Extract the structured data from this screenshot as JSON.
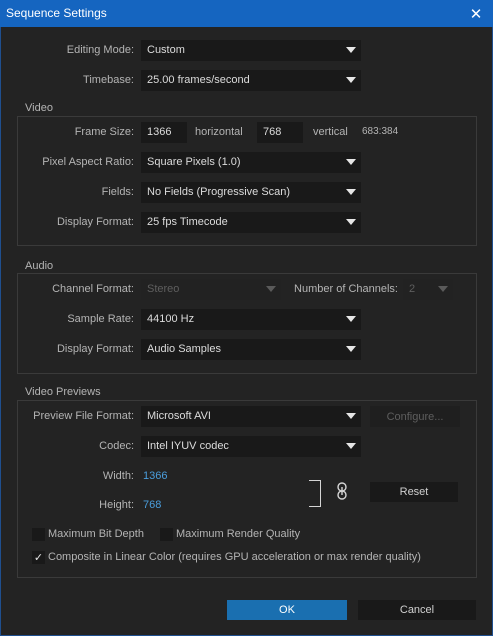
{
  "window": {
    "title": "Sequence Settings"
  },
  "general": {
    "editing_mode_label": "Editing Mode:",
    "editing_mode_value": "Custom",
    "timebase_label": "Timebase:",
    "timebase_value": "25.00 frames/second"
  },
  "video": {
    "group_title": "Video",
    "frame_size_label": "Frame Size:",
    "frame_width": "1366",
    "horizontal_label": "horizontal",
    "frame_height": "768",
    "vertical_label": "vertical",
    "aspect_ratio": "683:384",
    "par_label": "Pixel Aspect Ratio:",
    "par_value": "Square Pixels (1.0)",
    "fields_label": "Fields:",
    "fields_value": "No Fields (Progressive Scan)",
    "display_format_label": "Display Format:",
    "display_format_value": "25 fps Timecode"
  },
  "audio": {
    "group_title": "Audio",
    "channel_format_label": "Channel Format:",
    "channel_format_value": "Stereo",
    "channels_label": "Number of Channels:",
    "channels_value": "2",
    "sample_rate_label": "Sample Rate:",
    "sample_rate_value": "44100 Hz",
    "display_format_label": "Display Format:",
    "display_format_value": "Audio Samples"
  },
  "previews": {
    "group_title": "Video Previews",
    "preview_format_label": "Preview File Format:",
    "preview_format_value": "Microsoft AVI",
    "configure_label": "Configure...",
    "codec_label": "Codec:",
    "codec_value": "Intel IYUV codec",
    "width_label": "Width:",
    "width_value": "1366",
    "height_label": "Height:",
    "height_value": "768",
    "reset_label": "Reset"
  },
  "options": {
    "max_bit_depth": {
      "label": "Maximum Bit Depth",
      "checked": false
    },
    "max_render_quality": {
      "label": "Maximum Render Quality",
      "checked": false
    },
    "linear_color": {
      "label": "Composite in Linear Color (requires GPU acceleration or max render quality)",
      "checked": true,
      "mark": "✓"
    }
  },
  "footer": {
    "ok_label": "OK",
    "cancel_label": "Cancel"
  },
  "icons": {
    "close": "close-icon",
    "link": "link-icon",
    "dropdown": "chevron-down-icon"
  },
  "colors": {
    "title_bar": "#1565c0",
    "primary_button": "#1a6fb0",
    "link_value": "#4a9edd"
  }
}
